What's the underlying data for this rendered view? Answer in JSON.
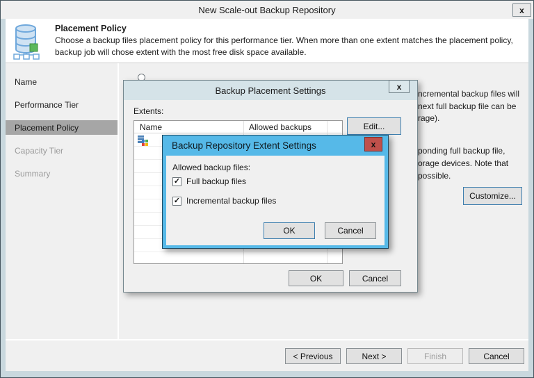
{
  "icons": {
    "close": "x",
    "check": "✓"
  },
  "colors": {
    "accent_blue": "#56B9E8",
    "close_red": "#C0504B",
    "selected_gray": "#A6A6A6",
    "frame": "#C9D8DE"
  },
  "main_window": {
    "title": "New Scale-out Backup Repository",
    "header": {
      "title": "Placement Policy",
      "desc1": "Choose a backup files placement policy for this performance tier. When more than one extent matches the placement policy,",
      "desc2": "backup job will chose extent with the most free disk space available."
    },
    "sidebar": {
      "items": [
        {
          "label": "Name",
          "state": "done"
        },
        {
          "label": "Performance Tier",
          "state": "done"
        },
        {
          "label": "Placement Policy",
          "state": "active"
        },
        {
          "label": "Capacity Tier",
          "state": "upcoming"
        },
        {
          "label": "Summary",
          "state": "upcoming"
        }
      ]
    },
    "content": {
      "fragment1_line1": "ncremental backup files will",
      "fragment1_line2": "next full backup file can be",
      "fragment1_line3": "rage).",
      "fragment2_line1": "ponding full backup file,",
      "fragment2_line2": "orage devices. Note that",
      "fragment2_line3": "possible.",
      "customize": "Customize..."
    },
    "footer": {
      "previous": "< Previous",
      "next": "Next >",
      "finish": "Finish",
      "cancel": "Cancel"
    }
  },
  "placement_dialog": {
    "title": "Backup Placement Settings",
    "extents_label": "Extents:",
    "columns": {
      "name": "Name",
      "allowed": "Allowed backups"
    },
    "edit": "Edit...",
    "ok": "OK",
    "cancel": "Cancel"
  },
  "extent_dialog": {
    "title": "Backup Repository Extent Settings",
    "allowed_label": "Allowed backup files:",
    "checkbox1": {
      "label": "Full backup files",
      "checked": true
    },
    "checkbox2": {
      "label": "Incremental backup files",
      "checked": true
    },
    "ok": "OK",
    "cancel": "Cancel"
  }
}
